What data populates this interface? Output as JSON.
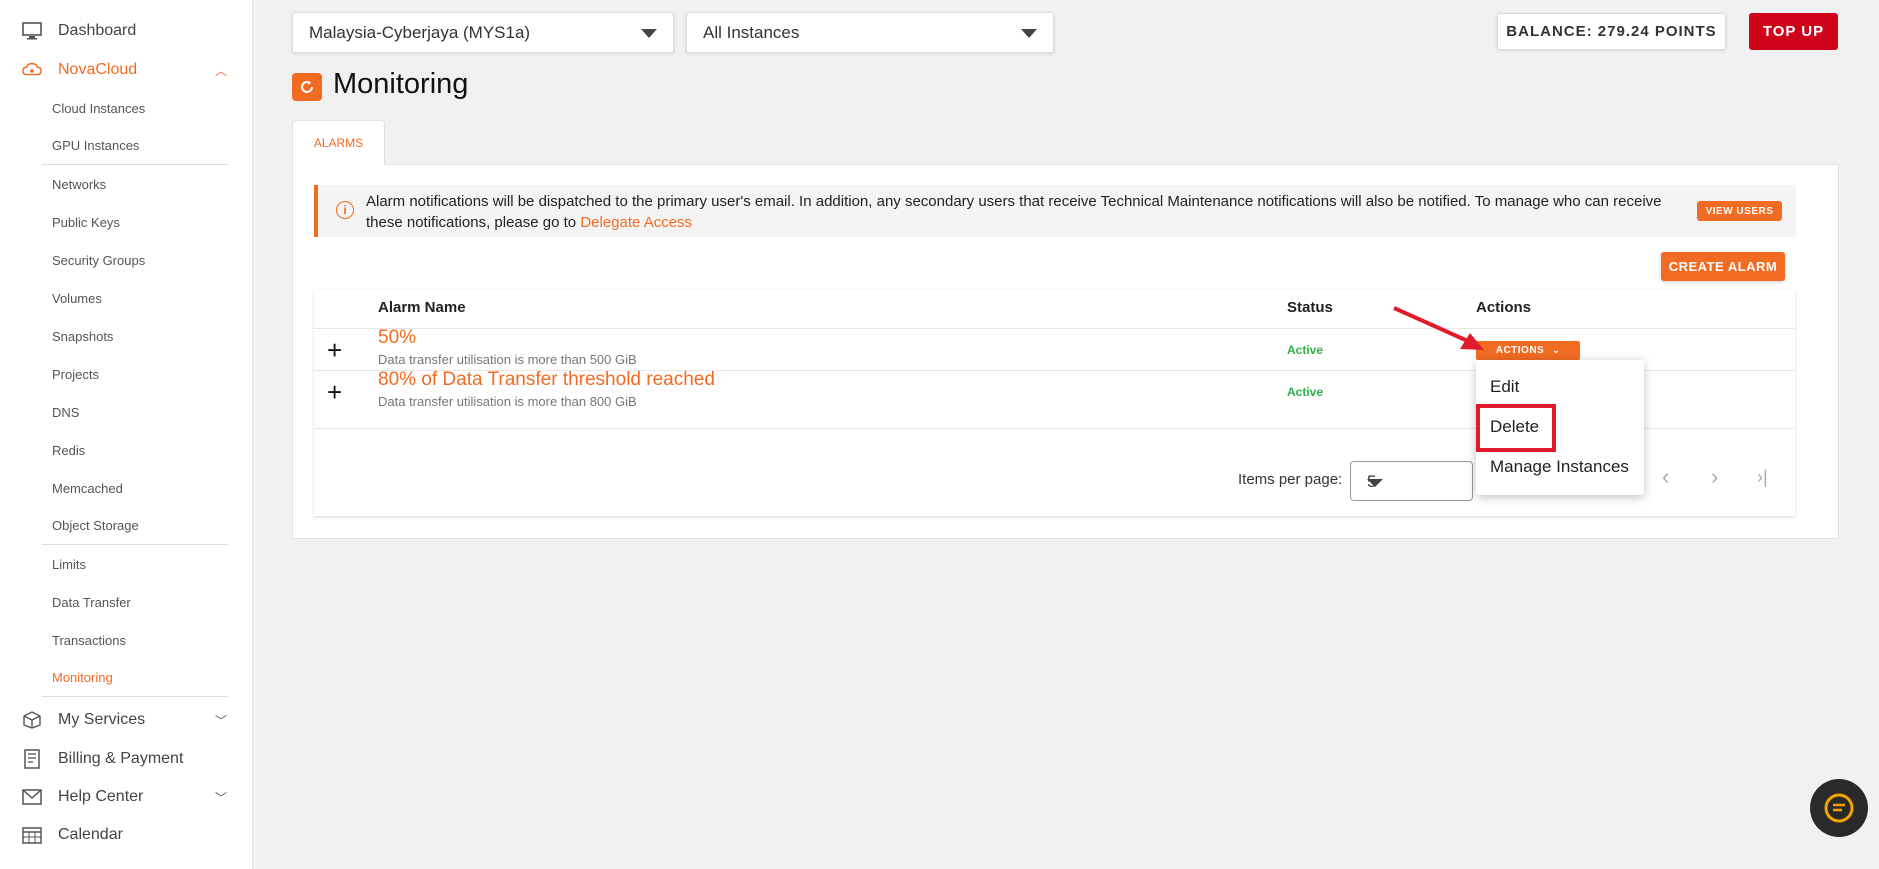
{
  "sidebar": {
    "dashboard": "Dashboard",
    "novacloud": "NovaCloud",
    "sub_items": [
      "Cloud Instances",
      "GPU Instances",
      "Networks",
      "Public Keys",
      "Security Groups",
      "Volumes",
      "Snapshots",
      "Projects",
      "DNS",
      "Redis",
      "Memcached",
      "Object Storage",
      "Limits",
      "Data Transfer",
      "Transactions",
      "Monitoring"
    ],
    "my_services": "My Services",
    "billing": "Billing & Payment",
    "help_center": "Help Center",
    "calendar": "Calendar"
  },
  "topbar": {
    "region": "Malaysia-Cyberjaya (MYS1a)",
    "instances": "All Instances",
    "balance": "BALANCE: 279.24 POINTS",
    "topup": "TOP UP"
  },
  "page": {
    "title": "Monitoring",
    "tab": "ALARMS"
  },
  "alert": {
    "text": "Alarm notifications will be dispatched to the primary user's email. In addition, any secondary users that receive Technical Maintenance notifications will also be notified. To manage who can receive these notifications, please go to ",
    "link": "Delegate Access",
    "view_users": "VIEW USERS"
  },
  "create_alarm": "CREATE ALARM",
  "table": {
    "headers": {
      "name": "Alarm Name",
      "status": "Status",
      "actions": "Actions"
    },
    "rows": [
      {
        "name": "50%",
        "description": "Data transfer utilisation is more than 500 GiB",
        "status": "Active"
      },
      {
        "name": "80% of Data Transfer threshold reached",
        "description": "Data transfer utilisation is more than 800 GiB",
        "status": "Active"
      }
    ],
    "actions_button": "ACTIONS"
  },
  "pagination": {
    "items_per_page_label": "Items per page:",
    "items_per_page": "5"
  },
  "dropdown_menu": [
    "Edit",
    "Delete",
    "Manage Instances"
  ],
  "colors": {
    "accent": "#f26b22",
    "topup": "#d0021b",
    "active_status": "#2db14a",
    "highlight": "#e01b2b"
  }
}
